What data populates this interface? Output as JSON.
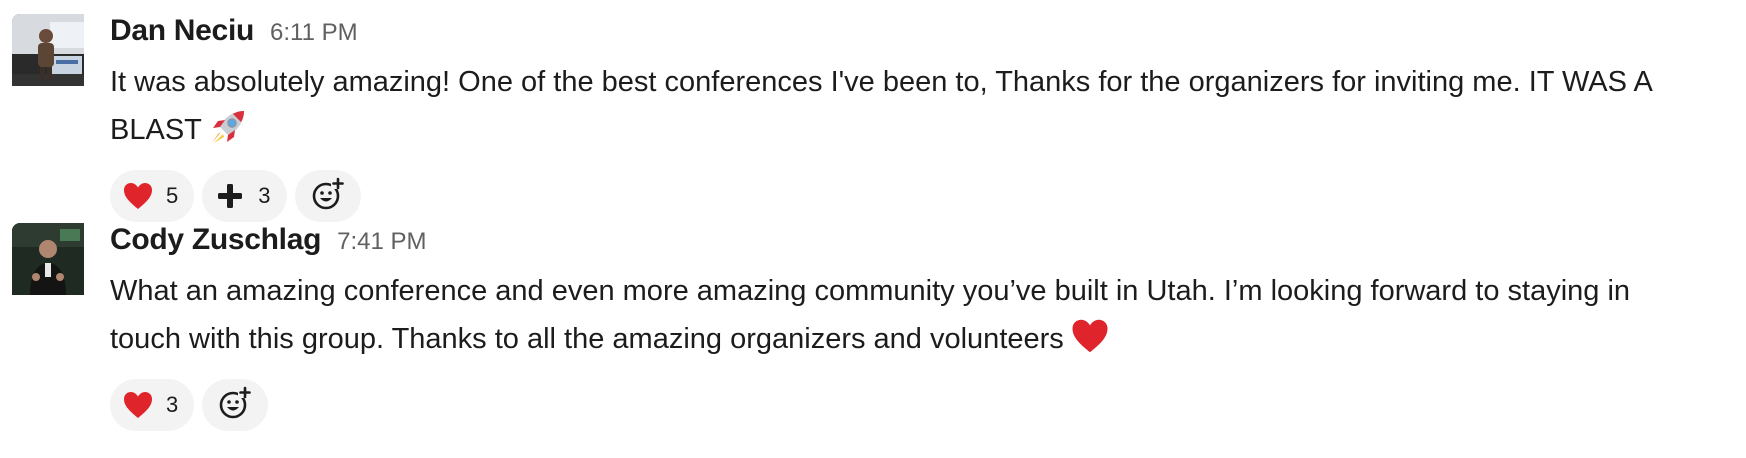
{
  "messages": [
    {
      "username": "Dan Neciu",
      "time": "6:11 PM",
      "text": "It was absolutely amazing! One of the best conferences I've been to, Thanks for the organizers for inviting me. IT WAS A BLAST",
      "inline_emoji": "rocket",
      "reactions": [
        {
          "emoji": "heart",
          "count": "5"
        },
        {
          "emoji": "heavy-plus",
          "count": "3"
        }
      ]
    },
    {
      "username": "Cody Zuschlag",
      "time": "7:41 PM",
      "text": "What an amazing conference and even more amazing community you’ve built in Utah. I’m looking forward to staying in touch with this group. Thanks to all the amazing organizers and volunteers",
      "inline_emoji": "heart",
      "reactions": [
        {
          "emoji": "heart",
          "count": "3"
        }
      ]
    }
  ],
  "colors": {
    "text": "#1d1c1d",
    "timestamp": "#616061",
    "reaction_bg": "#f3f3f3",
    "heart": "#e0242b"
  }
}
